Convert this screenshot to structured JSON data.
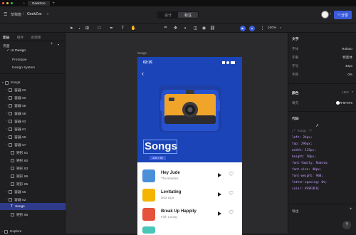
{
  "window": {
    "tabs": [
      {
        "label": "GeekZoo"
      }
    ],
    "add_tab": "+"
  },
  "titlebar": {
    "project_label": "草稿箱",
    "separator": "/",
    "file_name": "GeekZoo",
    "mode_tabs": [
      "设计",
      "标注"
    ],
    "active_mode": "标注",
    "share_label": "分享"
  },
  "toolbar": {
    "zoom": "100%"
  },
  "left_panel": {
    "tabs": [
      "图层",
      "组件",
      "资源库"
    ],
    "pages_label": "页面",
    "pages": [
      {
        "label": "UI Design",
        "checked": true
      },
      {
        "label": "Prototype",
        "checked": false
      },
      {
        "label": "Design System",
        "checked": false
      }
    ],
    "layers": [
      {
        "label": "Songs"
      },
      {
        "label": "容器 62"
      },
      {
        "label": "容器 60"
      },
      {
        "label": "容器 58"
      },
      {
        "label": "容器 58"
      },
      {
        "label": "容器 62"
      },
      {
        "label": "容器 61"
      },
      {
        "label": "容器 59"
      },
      {
        "label": "容器 57"
      },
      {
        "label": "矩形 81"
      },
      {
        "label": "矩形 80"
      },
      {
        "label": "矩形 83"
      },
      {
        "label": "矩形 86"
      },
      {
        "label": "矩形 85"
      },
      {
        "label": "容器 56"
      },
      {
        "label": "容器 52"
      },
      {
        "label": "Songs"
      },
      {
        "label": "矩形 65"
      },
      {
        "label": "Explore"
      }
    ]
  },
  "canvas": {
    "frame_label": "Songs",
    "phone": {
      "time": "02:15",
      "title": "Songs",
      "selection_size": "115 × 50",
      "songs": [
        {
          "title": "Hey Jude",
          "artist": "The Beatles",
          "color": "#4a90d9"
        },
        {
          "title": "Levitating",
          "artist": "Dua Lipa",
          "color": "#f4b400"
        },
        {
          "title": "Break Up Happily",
          "artist": "Fish Leong",
          "color": "#e5533d"
        }
      ]
    }
  },
  "right_panel": {
    "text_section": "文字",
    "props": [
      {
        "key": "字体",
        "value": "Roboto"
      },
      {
        "key": "字重",
        "value": "特黑体"
      },
      {
        "key": "字号",
        "value": "40px"
      },
      {
        "key": "字距",
        "value": "0%"
      }
    ],
    "color_section": "颜色",
    "color_format": "HEX",
    "fill_label": "填充",
    "fill_value": "#F8F8F8",
    "code_section": "代码",
    "code_lines": [
      "/* Songs */",
      "left: 24px;",
      "top: 296px;",
      "width: 115px;",
      "height: 50px;",
      "font-family: Roboto;",
      "font-size: 40px;",
      "font-weight: 900;",
      "letter-spacing: 0%;",
      "color: #F8F8F8;"
    ],
    "export_label": "导出",
    "help": "?"
  },
  "colors": {
    "accent": "#3a5bd9",
    "hero_bg": "#1a44b8",
    "selection": "#2f3a8a"
  }
}
